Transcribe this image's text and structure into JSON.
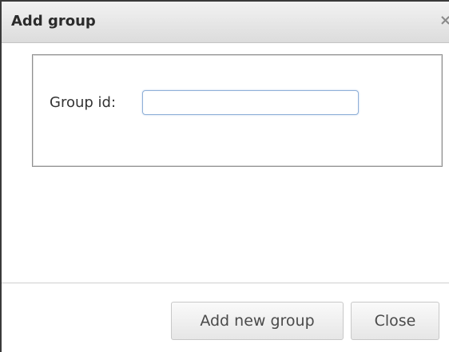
{
  "dialog": {
    "title": "Add group",
    "close_glyph": "×",
    "close_icon": "close-icon"
  },
  "form": {
    "group_id_label": "Group id:",
    "group_id_value": ""
  },
  "footer": {
    "add_button_label": "Add new group",
    "close_button_label": "Close"
  }
}
